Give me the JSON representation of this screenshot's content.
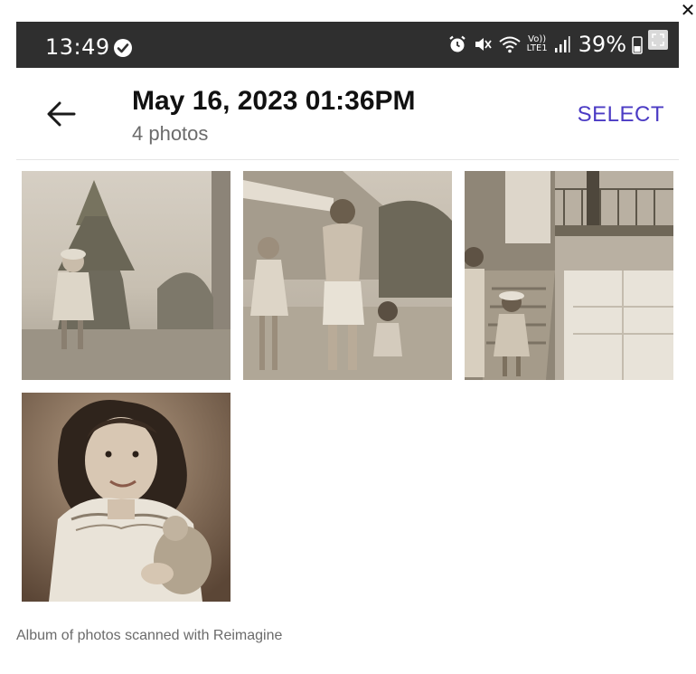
{
  "status_bar": {
    "time": "13:49",
    "battery": "39%",
    "signal_label": "LTE1"
  },
  "header": {
    "title": "May 16, 2023 01:36PM",
    "photo_count": "4 photos",
    "select_label": "SELECT"
  },
  "photos": [
    {
      "name": "girl-by-tree"
    },
    {
      "name": "man-and-children-on-street"
    },
    {
      "name": "children-by-house-stairs"
    },
    {
      "name": "girl-portrait-with-doll"
    }
  ],
  "caption": "Album of photos scanned with Reimagine",
  "colors": {
    "status_bar": "#2f2f2f",
    "accent": "#4b3bc4",
    "sepia_light": "#d8d0c4",
    "sepia_dark": "#3a2f28"
  },
  "icons": {
    "close": "close-icon",
    "back": "arrow-left-icon",
    "alarm": "alarm-icon",
    "mute": "mute-icon",
    "wifi": "wifi-icon",
    "signal": "signal-icon",
    "battery": "battery-icon",
    "check": "check-circle-icon",
    "expand": "expand-icon"
  }
}
